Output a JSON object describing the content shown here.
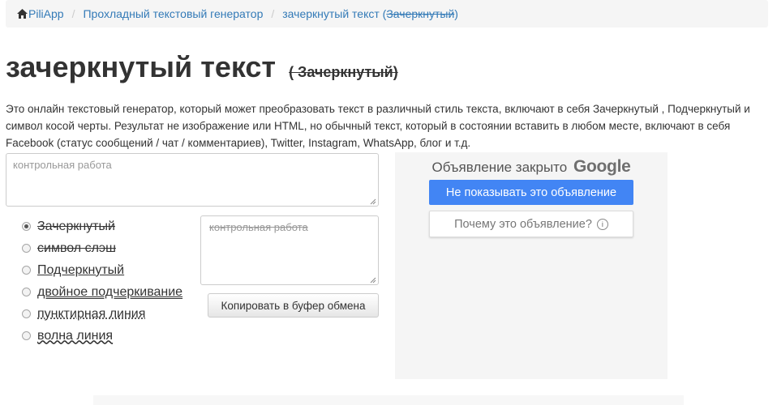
{
  "breadcrumb": {
    "home": "PiliApp",
    "section": "Прохладный текстовый генератор",
    "current_main": "зачеркнутый текст (",
    "current_strike": "Зачеркнутый",
    "current_close": ")"
  },
  "title": {
    "main": "зачеркнутый текст",
    "sub": "( Зачеркнутый)"
  },
  "description": "Это онлайн текстовый генератор, который может преобразовать текст в различный стиль текста, включают в себя Зачеркнутый , Подчеркнутый и символ косой черты. Результат не изображение или HTML, но обычный текст, который в состоянии вставить в любом месте, включают в себя Facebook (статус сообщений / чат / комментариев), Twitter, Instagram, WhatsApp, блог и т.д.",
  "input": {
    "placeholder": "контрольная работа"
  },
  "options": [
    {
      "label": "Зачеркнутый",
      "selected": true
    },
    {
      "label": "символ слэш",
      "selected": false
    },
    {
      "label": "Подчеркнутый",
      "selected": false
    },
    {
      "label": "двойное подчеркивание",
      "selected": false
    },
    {
      "label": "пунктирная линия",
      "selected": false
    },
    {
      "label": "волна линия",
      "selected": false
    }
  ],
  "output": {
    "text": "контрольная работа"
  },
  "copy_button": "Копировать в буфер обмена",
  "ad": {
    "closed_text": "Объявление закрыто",
    "google": "Google",
    "hide_button": "Не показывать это объявление",
    "why_button": "Почему это объявление?",
    "info_glyph": "i"
  },
  "colors": {
    "link": "#337ab7",
    "ad_blue": "#4285f4",
    "breadcrumb_bg": "#f5f5f5"
  }
}
